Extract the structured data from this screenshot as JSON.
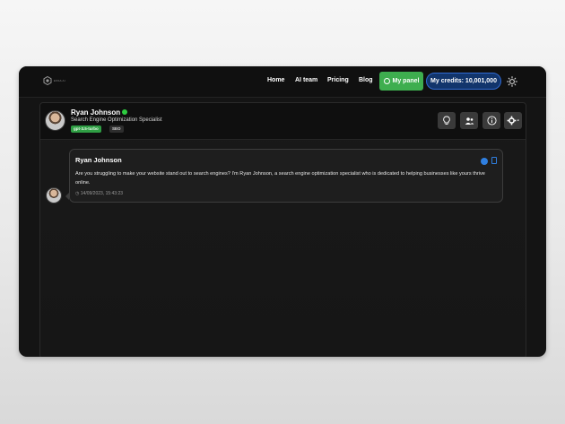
{
  "nav": {
    "logo_text": "ESSA AI",
    "links": [
      "Home",
      "AI team",
      "Pricing",
      "Blog"
    ],
    "panel_label": "My panel",
    "credits_label": "My credits: 10,001,000"
  },
  "profile": {
    "name": "Ryan Johnson",
    "title": "Search Engine Optimization Specialist",
    "tags": [
      "gpt-3.5-turbo",
      "SEO"
    ],
    "status_color": "#2ecc40"
  },
  "tools": [
    "lightbulb-icon",
    "users-icon",
    "info-icon",
    "gear-icon"
  ],
  "message": {
    "author": "Ryan Johnson",
    "text": "Are you struggling to make your website stand out to search engines? I'm Ryan Johnson, a search engine optimization specialist who is dedicated to helping businesses like yours thrive online.",
    "timestamp": "14/09/2023, 15:43:23"
  },
  "colors": {
    "accent_green": "#3eae4f",
    "credits_blue": "#12356c",
    "link_blue": "#2f7fe0"
  }
}
